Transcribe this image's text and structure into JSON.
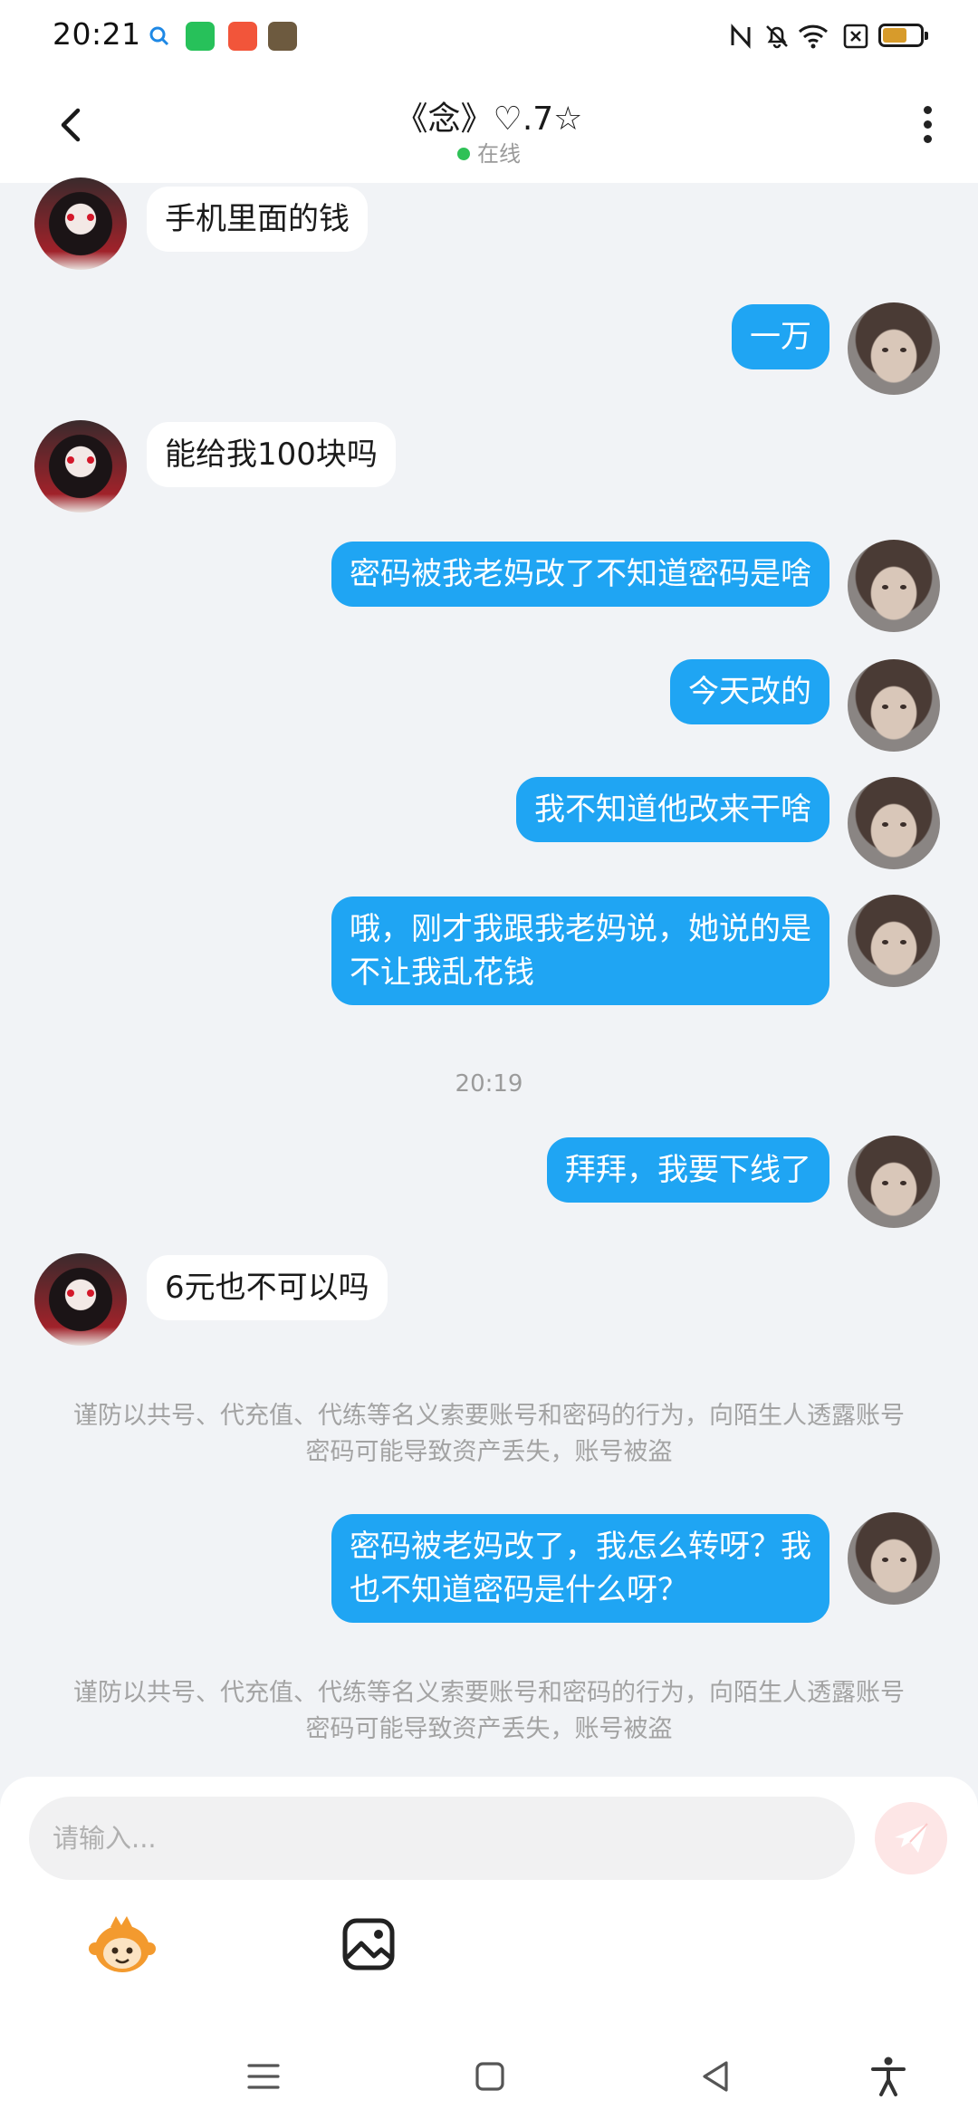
{
  "status_bar": {
    "time": "20:21",
    "icons": [
      "search-icon",
      "green-app-icon",
      "orange-app-icon",
      "game-app-icon",
      "nfc-icon",
      "mute-icon",
      "wifi-icon",
      "no-sim-icon",
      "battery-icon"
    ]
  },
  "header": {
    "title": "《念》♡.7☆",
    "status": "在线",
    "status_color": "#2fc157"
  },
  "messages": [
    {
      "sender": "peer",
      "text": "手机里面的钱"
    },
    {
      "sender": "me",
      "text": "一万"
    },
    {
      "sender": "peer",
      "text": "能给我100块吗"
    },
    {
      "sender": "me",
      "text": "密码被我老妈改了不知道密码是啥"
    },
    {
      "sender": "me",
      "text": "今天改的"
    },
    {
      "sender": "me",
      "text": "我不知道他改来干啥"
    },
    {
      "sender": "me",
      "text": "哦，刚才我跟我老妈说，她说的是\n不让我乱花钱"
    },
    {
      "sender": "me",
      "text": "拜拜，我要下线了"
    },
    {
      "sender": "peer",
      "text": "6元也不可以吗"
    },
    {
      "sender": "me",
      "text": "密码被老妈改了，我怎么转呀？我\n也不知道密码是什么呀？"
    }
  ],
  "timestamp": "20:19",
  "security_notice": "谨防以共号、代充值、代练等名义索要账号和密码的行为，向陌生人透露账号密码可能导致资产丢失，账号被盗",
  "composer": {
    "placeholder": "请输入...",
    "send_color": "#fde6e6"
  },
  "colors": {
    "my_bubble": "#1fa5f3",
    "peer_bubble": "#ffffff",
    "background": "#f1f3f6"
  }
}
